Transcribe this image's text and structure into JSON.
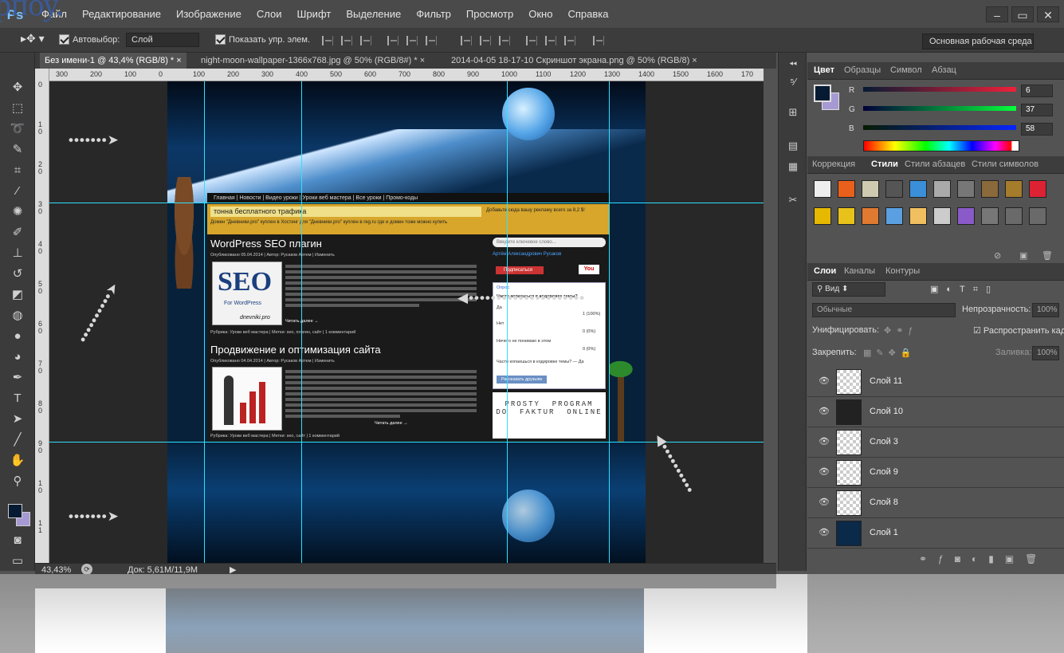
{
  "app": {
    "logo": "Ps",
    "cut_title": "рпоу."
  },
  "menu": [
    "Файл",
    "Редактирование",
    "Изображение",
    "Слои",
    "Шрифт",
    "Выделение",
    "Фильтр",
    "Просмотр",
    "Окно",
    "Справка"
  ],
  "window_buttons": {
    "minimize": "–",
    "restore": "▭",
    "close": "✕"
  },
  "options": {
    "autoselect_label": "Автовыбор:",
    "autoselect_value": "Слой",
    "show_controls_label": "Показать упр. элем.",
    "workspace": "Основная рабочая среда"
  },
  "tabs": [
    {
      "label": "Без имени-1 @ 43,4% (RGB/8) *  ×",
      "active": true
    },
    {
      "label": "night-moon-wallpaper-1366x768.jpg @ 50% (RGB/8#) *  ×",
      "active": false
    },
    {
      "label": "2014-04-05 18-17-10 Скриншот экрана.png @ 50% (RGB/8)  ×",
      "active": false
    }
  ],
  "ruler_h": [
    "300",
    "200",
    "100",
    "0",
    "100",
    "200",
    "300",
    "400",
    "500",
    "600",
    "700",
    "800",
    "900",
    "1000",
    "1100",
    "1200",
    "1300",
    "1400",
    "1500",
    "1600",
    "170"
  ],
  "ruler_v": [
    "0",
    "1\n0",
    "2\n0",
    "3\n0",
    "4\n0",
    "5\n0",
    "6\n0",
    "7\n0",
    "8\n0",
    "9\n0",
    "1\n0",
    "1\n1"
  ],
  "status": {
    "zoom": "43,43%",
    "doc": "Док: 5,61M/11,9M"
  },
  "blog": {
    "nav": "Главная | Новости | Видео уроки | Уроки веб мастера | Все уроки | Промо-коды",
    "banner": "тонна бесплатного трафика",
    "banner_right": "Добавьте сюда вашу рекламу всего за 8,2 $!",
    "banner_sub": "Домен \"Дневники.pro\" куплен в  Хостинг для \"Дневники.pro\" куплен в  reg.ru  где и домен тоже можно купить",
    "post1": {
      "title": "WordPress SEO плагин",
      "meta": "Опубликовано 05.04.2014 | Автор: Русаков Артем | Изменить",
      "thumb": "SEO",
      "thumb_sub": "For WordPress",
      "watermark": "dnevniki.pro",
      "more": "Читать далее →",
      "footer": "Рубрика: Уроки веб мастера | Метки: seo, плагин, сайт | 1 комментарий"
    },
    "post2": {
      "title": "Продвижение и оптимизация сайта",
      "meta": "Опубликовано 04.04.2014 | Автор: Русаков Артем | Изменить",
      "more": "Читать далее →",
      "footer": "Рубрика: Уроки веб мастера | Метки: seo, сайт | 1 комментарий"
    },
    "sidebar": {
      "search": "Введите ключевое слово...",
      "author": "Артём Александрович Русаков",
      "subscribe": "Подписаться",
      "poll_title": "Опрос",
      "poll_q": "Часто копаешься в кодировке темы?",
      "poll_a1": "Да",
      "poll_v1": "1 (100%)",
      "poll_a2": "Нет",
      "poll_v2": "0 (0%)",
      "poll_a3": "Ничего не понимаю в этом",
      "poll_v3": "0 (0%)",
      "poll_share": "Часто копаешься в кодировке темы? — Да",
      "poll_button": "Рассказать друзьям",
      "ad": "PROSTY  PROGRAM\nDO  FAKTUR  ONLINE"
    }
  },
  "color_panel": {
    "tabs": [
      "Цвет",
      "Образцы",
      "Символ",
      "Абзац"
    ],
    "r": "6",
    "g": "37",
    "b": "58",
    "r_label": "R",
    "g_label": "G",
    "b_label": "B"
  },
  "styles_panel": {
    "tabs": [
      "Коррекция",
      "Стили",
      "Стили абзацев",
      "Стили символов"
    ]
  },
  "layers_panel": {
    "tabs": [
      "Слои",
      "Каналы",
      "Контуры"
    ],
    "filter": "Вид",
    "blend": "Обычные",
    "opacity_label": "Непрозрачность:",
    "opacity": "100%",
    "unify_label": "Унифицировать:",
    "propagate_label": "Распространить кадр",
    "lock_label": "Закрепить:",
    "fill_label": "Заливка:",
    "fill": "100%",
    "layers": [
      "Слой 11",
      "Слой 10",
      "Слой 3",
      "Слой 9",
      "Слой 8",
      "Слой 1"
    ]
  },
  "colors": {
    "foreground": "#061b33",
    "background": "#a79ad4",
    "guide": "#2de1ff",
    "panel": "#535353"
  }
}
